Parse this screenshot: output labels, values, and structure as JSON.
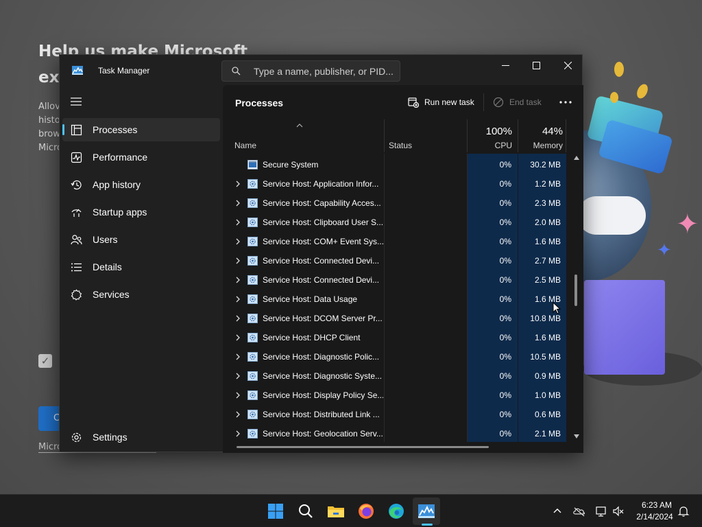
{
  "background": {
    "title_line1": "Help us make Microsoft",
    "title_line2": "exp",
    "body_lines": [
      "Allov",
      "histo",
      "brow",
      "Micro"
    ],
    "button_label": "C",
    "link_label": "Micro"
  },
  "window": {
    "title": "Task Manager",
    "search_placeholder": "Type a name, publisher, or PID...",
    "controls": [
      "minimize",
      "maximize",
      "close"
    ]
  },
  "nav": {
    "items": [
      {
        "label": "Processes",
        "icon": "processes-icon",
        "active": true
      },
      {
        "label": "Performance",
        "icon": "performance-icon"
      },
      {
        "label": "App history",
        "icon": "app-history-icon"
      },
      {
        "label": "Startup apps",
        "icon": "startup-apps-icon"
      },
      {
        "label": "Users",
        "icon": "users-icon"
      },
      {
        "label": "Details",
        "icon": "details-icon"
      },
      {
        "label": "Services",
        "icon": "services-icon"
      }
    ],
    "settings_label": "Settings"
  },
  "content": {
    "page_title": "Processes",
    "run_new_task": "Run new task",
    "end_task": "End task",
    "columns": {
      "name": "Name",
      "status": "Status",
      "cpu_pct": "100%",
      "cpu": "CPU",
      "mem_pct": "44%",
      "memory": "Memory"
    },
    "rows": [
      {
        "name": "Secure System",
        "cpu": "0%",
        "mem": "30.2 MB",
        "expandable": false
      },
      {
        "name": "Service Host: Application Infor...",
        "cpu": "0%",
        "mem": "1.2 MB",
        "expandable": true
      },
      {
        "name": "Service Host: Capability Acces...",
        "cpu": "0%",
        "mem": "2.3 MB",
        "expandable": true
      },
      {
        "name": "Service Host: Clipboard User S...",
        "cpu": "0%",
        "mem": "2.0 MB",
        "expandable": true
      },
      {
        "name": "Service Host: COM+ Event Sys...",
        "cpu": "0%",
        "mem": "1.6 MB",
        "expandable": true
      },
      {
        "name": "Service Host: Connected Devi...",
        "cpu": "0%",
        "mem": "2.7 MB",
        "expandable": true
      },
      {
        "name": "Service Host: Connected Devi...",
        "cpu": "0%",
        "mem": "2.5 MB",
        "expandable": true
      },
      {
        "name": "Service Host: Data Usage",
        "cpu": "0%",
        "mem": "1.6 MB",
        "expandable": true
      },
      {
        "name": "Service Host: DCOM Server Pr...",
        "cpu": "0%",
        "mem": "10.8 MB",
        "expandable": true
      },
      {
        "name": "Service Host: DHCP Client",
        "cpu": "0%",
        "mem": "1.6 MB",
        "expandable": true
      },
      {
        "name": "Service Host: Diagnostic Polic...",
        "cpu": "0%",
        "mem": "10.5 MB",
        "expandable": true
      },
      {
        "name": "Service Host: Diagnostic Syste...",
        "cpu": "0%",
        "mem": "0.9 MB",
        "expandable": true
      },
      {
        "name": "Service Host: Display Policy Se...",
        "cpu": "0%",
        "mem": "1.0 MB",
        "expandable": true
      },
      {
        "name": "Service Host: Distributed Link ...",
        "cpu": "0%",
        "mem": "0.6 MB",
        "expandable": true
      },
      {
        "name": "Service Host: Geolocation Serv...",
        "cpu": "0%",
        "mem": "2.1 MB",
        "expandable": true
      }
    ]
  },
  "taskbar": {
    "apps": [
      "windows-start-icon",
      "search-icon",
      "file-explorer-icon",
      "firefox-icon",
      "edge-icon",
      "task-manager-icon"
    ],
    "tray": [
      "chevron-up-icon",
      "onedrive-icon",
      "network-icon",
      "volume-muted-icon",
      "notification-bell-icon"
    ],
    "time": "6:23 AM",
    "date": "2/14/2024"
  },
  "colors": {
    "accent": "#4cc2ff",
    "window_bg": "#202020",
    "content_bg": "#191919",
    "heat_bg": "#0e2a4b",
    "taskbar_bg": "#1c1c1c"
  }
}
